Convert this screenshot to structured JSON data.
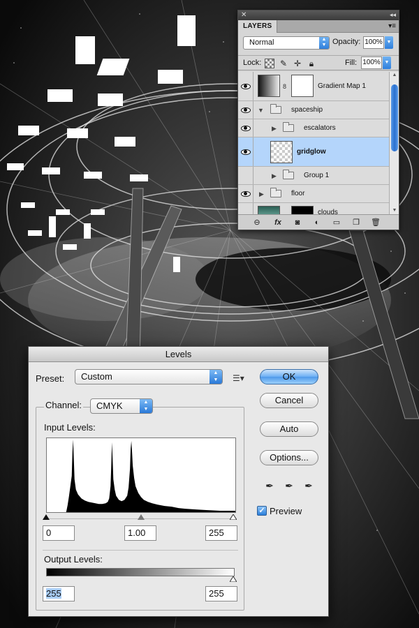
{
  "layers_panel": {
    "tab_label": "LAYERS",
    "blend_mode": "Normal",
    "opacity_label": "Opacity:",
    "opacity_value": "100%",
    "lock_label": "Lock:",
    "fill_label": "Fill:",
    "fill_value": "100%",
    "layers": [
      {
        "name": "Gradient Map 1",
        "kind": "adjustment",
        "visible": true
      },
      {
        "name": "spaceship",
        "kind": "group",
        "expanded": true,
        "visible": true
      },
      {
        "name": "escalators",
        "kind": "group",
        "expanded": false,
        "visible": true
      },
      {
        "name": "gridglow",
        "kind": "layer",
        "selected": true,
        "visible": true
      },
      {
        "name": "Group 1",
        "kind": "group",
        "expanded": false,
        "visible": true
      },
      {
        "name": "floor",
        "kind": "group",
        "expanded": false,
        "visible": true
      },
      {
        "name": "clouds",
        "kind": "layer",
        "visible": true
      }
    ]
  },
  "levels_dialog": {
    "title": "Levels",
    "preset_label": "Preset:",
    "preset_value": "Custom",
    "channel_label": "Channel:",
    "channel_value": "CMYK",
    "input_levels_label": "Input Levels:",
    "input_black": "0",
    "input_gamma": "1.00",
    "input_white": "255",
    "output_levels_label": "Output Levels:",
    "output_black": "255",
    "output_white": "255",
    "buttons": {
      "ok": "OK",
      "cancel": "Cancel",
      "auto": "Auto",
      "options": "Options..."
    },
    "preview_label": "Preview",
    "preview_checked": true
  }
}
